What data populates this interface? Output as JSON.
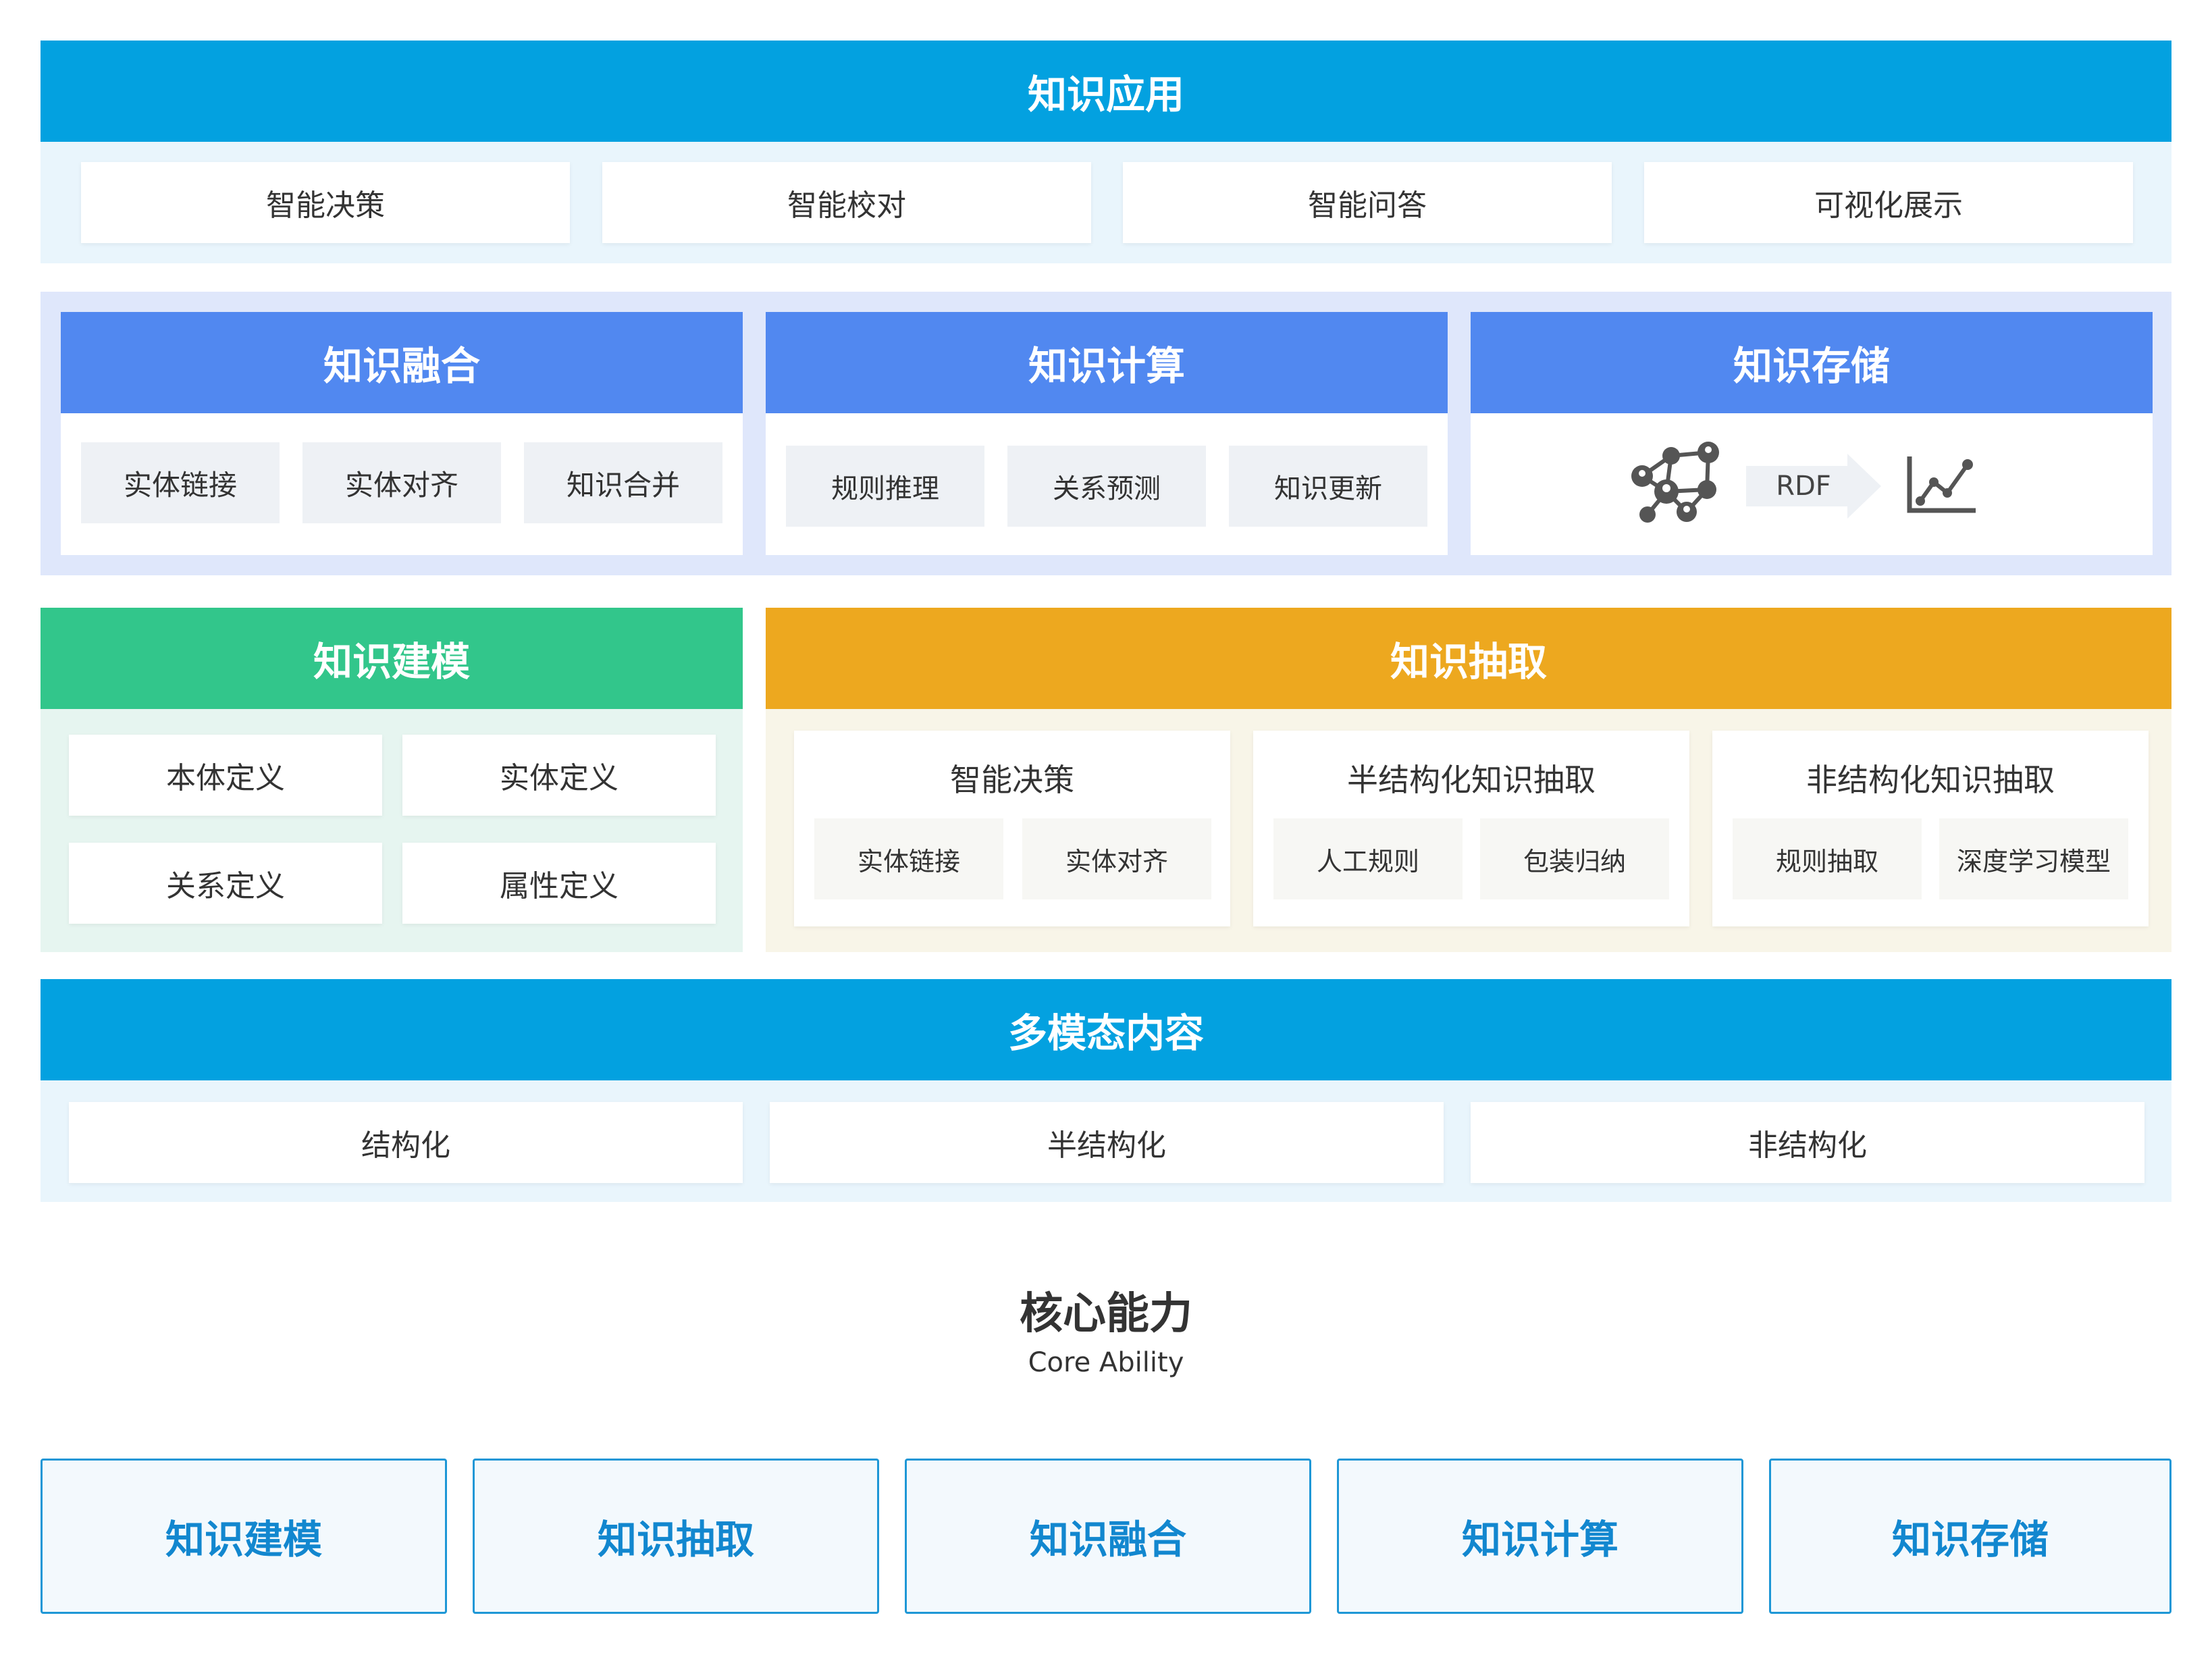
{
  "application": {
    "title": "知识应用",
    "items": [
      "智能决策",
      "智能校对",
      "智能问答",
      "可视化展示"
    ]
  },
  "fusion": {
    "title": "知识融合",
    "items": [
      "实体链接",
      "实体对齐",
      "知识合并"
    ]
  },
  "compute": {
    "title": "知识计算",
    "items": [
      "规则推理",
      "关系预测",
      "知识更新"
    ]
  },
  "storage": {
    "title": "知识存储",
    "rdf_label": "RDF"
  },
  "modeling": {
    "title": "知识建模",
    "items": [
      "本体定义",
      "实体定义",
      "关系定义",
      "属性定义"
    ]
  },
  "extraction": {
    "title": "知识抽取",
    "groups": [
      {
        "title": "智能决策",
        "items": [
          "实体链接",
          "实体对齐"
        ]
      },
      {
        "title": "半结构化知识抽取",
        "items": [
          "人工规则",
          "包装归纳"
        ]
      },
      {
        "title": "非结构化知识抽取",
        "items": [
          "规则抽取",
          "深度学习模型"
        ]
      }
    ]
  },
  "multimodal": {
    "title": "多模态内容",
    "items": [
      "结构化",
      "半结构化",
      "非结构化"
    ]
  },
  "core": {
    "title_cn": "核心能力",
    "title_en": "Core Ability",
    "items": [
      "知识建模",
      "知识抽取",
      "知识融合",
      "知识计算",
      "知识存储"
    ]
  },
  "colors": {
    "primary_blue": "#03a1e0",
    "periwinkle": "#5188f0",
    "green": "#32c68b",
    "orange": "#eda81f",
    "core_text": "#1287cf"
  }
}
